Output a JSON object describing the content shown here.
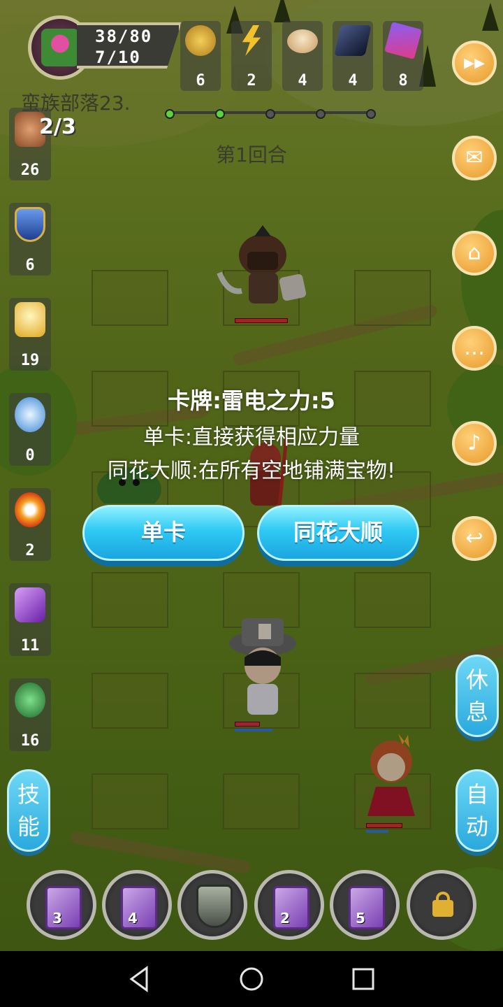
{
  "top": {
    "hp": "38/80",
    "energy": "7/10",
    "resources": [
      {
        "icon": "gold-coin-icon",
        "count": "6",
        "color": "#e2b33c"
      },
      {
        "icon": "lightning-icon",
        "count": "2",
        "color": "#f2c12e"
      },
      {
        "icon": "bread-icon",
        "count": "4",
        "color": "#e8c9a0"
      },
      {
        "icon": "ore-icon",
        "count": "4",
        "color": "#2c3a60"
      },
      {
        "icon": "crystal-icon",
        "count": "8",
        "color": "#c04fd0"
      }
    ]
  },
  "stage": {
    "tribe_name": "蛮族部落23.",
    "round": "第1回合",
    "fist_count": "2/3"
  },
  "left_items": [
    {
      "icon": "fist-icon",
      "count": "26",
      "color": "#c07a50"
    },
    {
      "icon": "shield-icon",
      "count": "6",
      "color": "#3b6fd0"
    },
    {
      "icon": "flame-tower-icon",
      "count": "19",
      "color": "#f0d060"
    },
    {
      "icon": "water-swirl-icon",
      "count": "0",
      "color": "#5fb0f0"
    },
    {
      "icon": "fire-burst-icon",
      "count": "2",
      "color": "#f06020"
    },
    {
      "icon": "purple-rune-icon",
      "count": "11",
      "color": "#9b4fd0"
    },
    {
      "icon": "green-potion-icon",
      "count": "16",
      "color": "#3ea050"
    }
  ],
  "right_buttons": [
    {
      "name": "fast-forward-button",
      "icon": "fast-forward-icon",
      "glyph": "▸▸"
    },
    {
      "name": "mail-button",
      "icon": "mail-icon",
      "glyph": "✉"
    },
    {
      "name": "home-button",
      "icon": "home-icon",
      "glyph": "⌂"
    },
    {
      "name": "chat-button",
      "icon": "chat-icon",
      "glyph": "…"
    },
    {
      "name": "sound-button",
      "icon": "speaker-icon",
      "glyph": "♪"
    },
    {
      "name": "back-button",
      "icon": "return-icon",
      "glyph": "↩"
    }
  ],
  "dialog": {
    "title": "卡牌:雷电之力:5",
    "line1": "单卡:直接获得相应力量",
    "line2": "同花大顺:在所有空地铺满宝物!",
    "single_button": "单卡",
    "flush_button": "同花大顺"
  },
  "side_pills": {
    "skills": "技\n能",
    "rest": "休\n息",
    "auto": "自\n动"
  },
  "skill_bar": [
    {
      "type": "card",
      "num": "3"
    },
    {
      "type": "card",
      "num": "4"
    },
    {
      "type": "shield",
      "num": ""
    },
    {
      "type": "card",
      "num": "2"
    },
    {
      "type": "card",
      "num": "5"
    },
    {
      "type": "lock",
      "num": ""
    }
  ],
  "navbar": {
    "back": "◁",
    "home": "○",
    "recents": "□"
  }
}
